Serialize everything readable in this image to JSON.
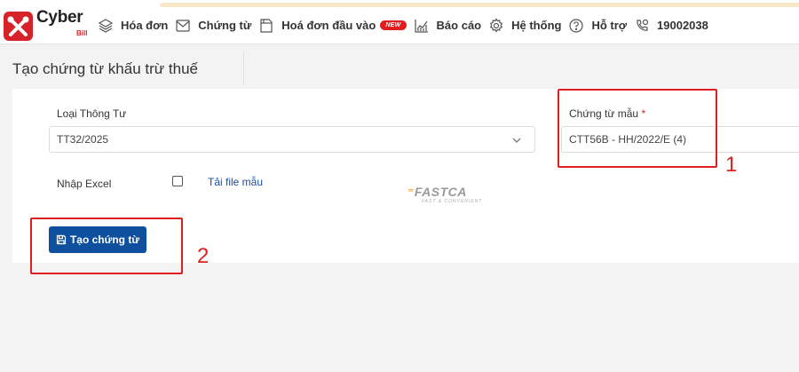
{
  "app": {
    "logo_text": "Cyber",
    "logo_sub": "Bill"
  },
  "nav": {
    "items": [
      {
        "label": "Hóa đơn",
        "icon": "layers-icon"
      },
      {
        "label": "Chứng từ",
        "icon": "envelope-icon"
      },
      {
        "label": "Hoá đơn đầu vào",
        "icon": "document-icon",
        "badge": "NEW"
      },
      {
        "label": "Báo cáo",
        "icon": "chart-icon"
      },
      {
        "label": "Hệ thống",
        "icon": "gear-icon"
      },
      {
        "label": "Hỗ trợ",
        "icon": "help-icon"
      },
      {
        "label": "19002038",
        "icon": "phone-icon"
      }
    ]
  },
  "page": {
    "title": "Tạo chứng từ khấu trừ thuế"
  },
  "form": {
    "circular_label": "Loại Thông Tư",
    "circular_value": "TT32/2025",
    "template_label": "Chứng từ mẫu",
    "template_required_mark": "*",
    "template_value": "CTT56B - HH/2022/E (4)",
    "import_excel_label": "Nhập Excel",
    "import_excel_checked": false,
    "download_template_link": "Tải file mẫu",
    "create_button_label": "Tạo chứng từ"
  },
  "watermark": {
    "brand": "FASTCA",
    "tagline": "FAST & CONVENIENT"
  },
  "annotations": {
    "first": "1",
    "second": "2",
    "color": "#e02020"
  },
  "colors": {
    "brand_red": "#d6232a",
    "primary_button": "#0e4f9e",
    "link": "#1b4ea0"
  }
}
